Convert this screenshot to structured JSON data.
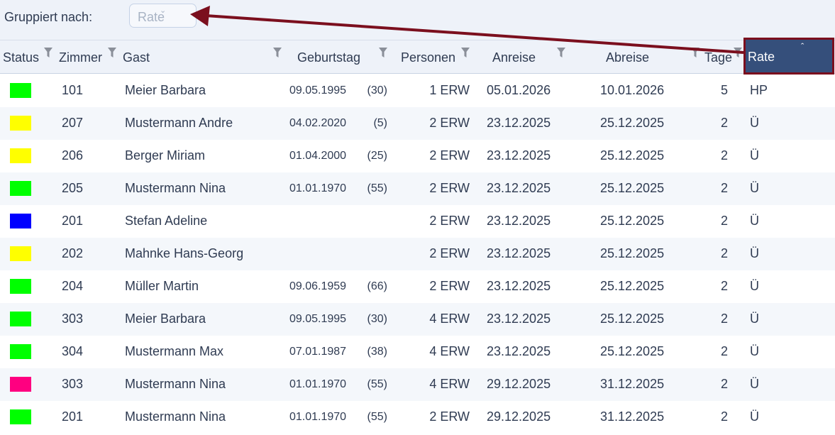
{
  "toolbar": {
    "group_label": "Gruppiert nach:",
    "group_value": "Rate",
    "group_chevron": "⌄"
  },
  "columns": {
    "status": "Status",
    "zimmer": "Zimmer",
    "gast": "Gast",
    "geburtstag": "Geburtstag",
    "personen": "Personen",
    "anreise": "Anreise",
    "abreise": "Abreise",
    "tage": "Tage",
    "rate": "Rate",
    "rate_sort": "ˆ"
  },
  "icons": {
    "filter": "filter-icon",
    "sort": "sort-asc-icon",
    "chevron": "chevron-down-icon"
  },
  "colors": {
    "annotation_red": "#7b0f1e",
    "header_selected": "#354f7b",
    "status_green": "#00ff00",
    "status_yellow": "#ffff00",
    "status_blue": "#0000ff",
    "status_pink": "#ff0080"
  },
  "rows": [
    {
      "status": "#00ff00",
      "zimmer": "101",
      "gast": "Meier Barbara",
      "geburtstag": "09.05.1995",
      "alter": "(30)",
      "personen": "1 ERW",
      "anreise": "05.01.2026",
      "abreise": "10.01.2026",
      "tage": "5",
      "rate": "HP"
    },
    {
      "status": "#ffff00",
      "zimmer": "207",
      "gast": "Mustermann Andre",
      "geburtstag": "04.02.2020",
      "alter": "(5)",
      "personen": "2 ERW",
      "anreise": "23.12.2025",
      "abreise": "25.12.2025",
      "tage": "2",
      "rate": "Ü"
    },
    {
      "status": "#ffff00",
      "zimmer": "206",
      "gast": "Berger Miriam",
      "geburtstag": "01.04.2000",
      "alter": "(25)",
      "personen": "2 ERW",
      "anreise": "23.12.2025",
      "abreise": "25.12.2025",
      "tage": "2",
      "rate": "Ü"
    },
    {
      "status": "#00ff00",
      "zimmer": "205",
      "gast": "Mustermann Nina",
      "geburtstag": "01.01.1970",
      "alter": "(55)",
      "personen": "2 ERW",
      "anreise": "23.12.2025",
      "abreise": "25.12.2025",
      "tage": "2",
      "rate": "Ü"
    },
    {
      "status": "#0000ff",
      "zimmer": "201",
      "gast": "Stefan Adeline",
      "geburtstag": "",
      "alter": "",
      "personen": "2 ERW",
      "anreise": "23.12.2025",
      "abreise": "25.12.2025",
      "tage": "2",
      "rate": "Ü"
    },
    {
      "status": "#ffff00",
      "zimmer": "202",
      "gast": "Mahnke Hans-Georg",
      "geburtstag": "",
      "alter": "",
      "personen": "2 ERW",
      "anreise": "23.12.2025",
      "abreise": "25.12.2025",
      "tage": "2",
      "rate": "Ü"
    },
    {
      "status": "#00ff00",
      "zimmer": "204",
      "gast": "Müller Martin",
      "geburtstag": "09.06.1959",
      "alter": "(66)",
      "personen": "2 ERW",
      "anreise": "23.12.2025",
      "abreise": "25.12.2025",
      "tage": "2",
      "rate": "Ü"
    },
    {
      "status": "#00ff00",
      "zimmer": "303",
      "gast": "Meier Barbara",
      "geburtstag": "09.05.1995",
      "alter": "(30)",
      "personen": "4 ERW",
      "anreise": "23.12.2025",
      "abreise": "25.12.2025",
      "tage": "2",
      "rate": "Ü"
    },
    {
      "status": "#00ff00",
      "zimmer": "304",
      "gast": "Mustermann Max",
      "geburtstag": "07.01.1987",
      "alter": "(38)",
      "personen": "4 ERW",
      "anreise": "23.12.2025",
      "abreise": "25.12.2025",
      "tage": "2",
      "rate": "Ü"
    },
    {
      "status": "#ff0080",
      "zimmer": "303",
      "gast": "Mustermann Nina",
      "geburtstag": "01.01.1970",
      "alter": "(55)",
      "personen": "4 ERW",
      "anreise": "29.12.2025",
      "abreise": "31.12.2025",
      "tage": "2",
      "rate": "Ü"
    },
    {
      "status": "#00ff00",
      "zimmer": "201",
      "gast": "Mustermann Nina",
      "geburtstag": "01.01.1970",
      "alter": "(55)",
      "personen": "2 ERW",
      "anreise": "29.12.2025",
      "abreise": "31.12.2025",
      "tage": "2",
      "rate": "Ü"
    }
  ]
}
